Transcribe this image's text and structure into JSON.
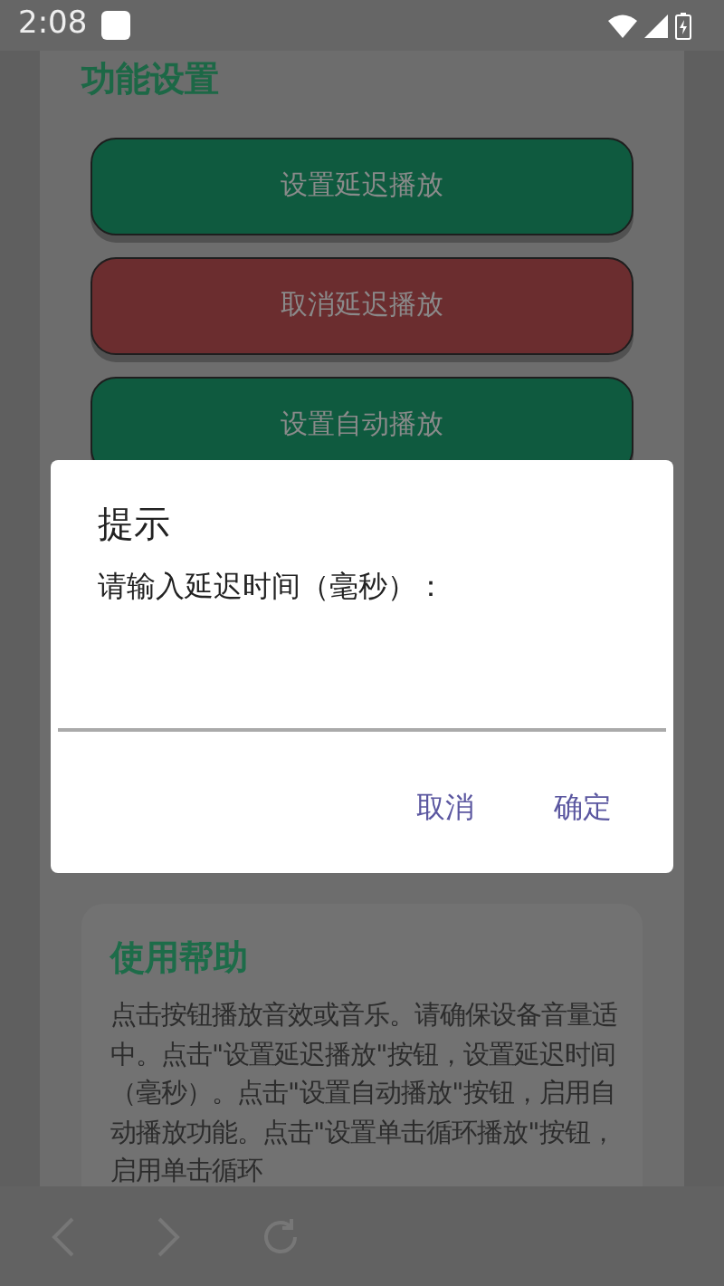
{
  "status_bar": {
    "time": "2:08"
  },
  "settings": {
    "title": "功能设置",
    "buttons": [
      {
        "label": "设置延迟播放",
        "color": "#0f5a3f"
      },
      {
        "label": "取消延迟播放",
        "color": "#6b2d2f"
      },
      {
        "label": "设置自动播放",
        "color": "#0f5a3f"
      }
    ]
  },
  "help": {
    "title": "使用帮助",
    "text": "点击按钮播放音效或音乐。请确保设备音量适中。点击\"设置延迟播放\"按钮，设置延迟时间（毫秒）。点击\"设置自动播放\"按钮，启用自动播放功能。点击\"设置单击循环播放\"按钮，启用单击循环"
  },
  "dialog": {
    "title": "提示",
    "message": "请输入延迟时间（毫秒）：",
    "buttons": [
      "取消",
      "确定"
    ]
  }
}
